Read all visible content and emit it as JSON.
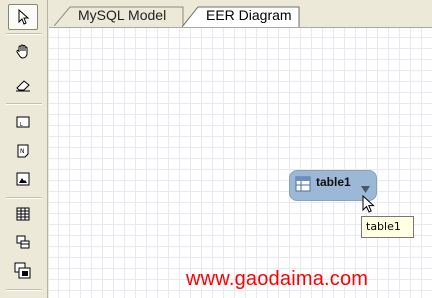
{
  "tabs": [
    {
      "label": "MySQL Model",
      "active": false
    },
    {
      "label": "EER Diagram",
      "active": true
    }
  ],
  "toolbar": {
    "tools": [
      {
        "icon": "pointer-icon",
        "selected": true
      },
      {
        "icon": "hand-icon"
      },
      {
        "icon": "eraser-icon"
      },
      {
        "icon": "layer-icon"
      },
      {
        "icon": "note-icon"
      },
      {
        "icon": "image-icon"
      },
      {
        "icon": "table-grid-icon"
      },
      {
        "icon": "view-icon"
      },
      {
        "icon": "routine-group-icon"
      }
    ]
  },
  "diagram": {
    "table": {
      "name": "table1"
    },
    "tooltip": "table1"
  },
  "watermark": "www.gaodaima.com",
  "colors": {
    "toolbar_bg": "#ece9d8",
    "table_node": "#9db8d6",
    "tooltip_bg": "#ffffe1",
    "watermark": "#ff0000"
  }
}
